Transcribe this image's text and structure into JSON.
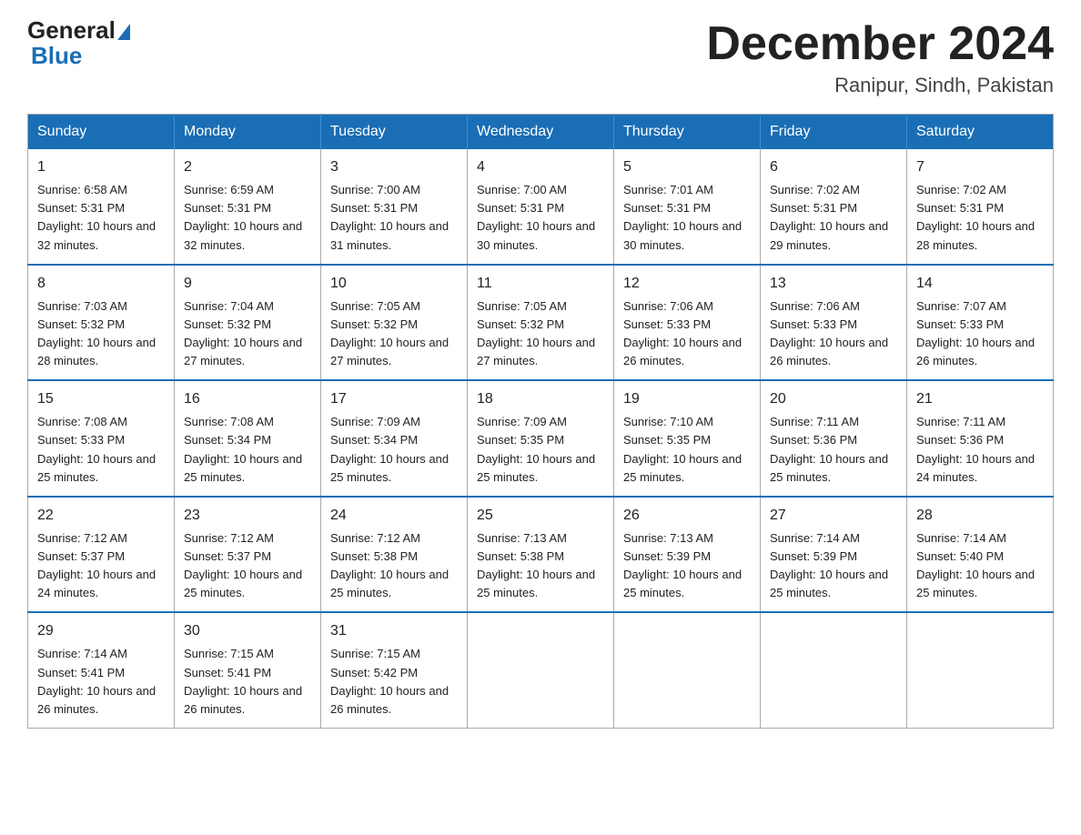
{
  "logo": {
    "general": "General",
    "blue": "Blue"
  },
  "header": {
    "month": "December 2024",
    "location": "Ranipur, Sindh, Pakistan"
  },
  "days_of_week": [
    "Sunday",
    "Monday",
    "Tuesday",
    "Wednesday",
    "Thursday",
    "Friday",
    "Saturday"
  ],
  "weeks": [
    [
      {
        "day": "1",
        "sunrise": "6:58 AM",
        "sunset": "5:31 PM",
        "daylight": "10 hours and 32 minutes."
      },
      {
        "day": "2",
        "sunrise": "6:59 AM",
        "sunset": "5:31 PM",
        "daylight": "10 hours and 32 minutes."
      },
      {
        "day": "3",
        "sunrise": "7:00 AM",
        "sunset": "5:31 PM",
        "daylight": "10 hours and 31 minutes."
      },
      {
        "day": "4",
        "sunrise": "7:00 AM",
        "sunset": "5:31 PM",
        "daylight": "10 hours and 30 minutes."
      },
      {
        "day": "5",
        "sunrise": "7:01 AM",
        "sunset": "5:31 PM",
        "daylight": "10 hours and 30 minutes."
      },
      {
        "day": "6",
        "sunrise": "7:02 AM",
        "sunset": "5:31 PM",
        "daylight": "10 hours and 29 minutes."
      },
      {
        "day": "7",
        "sunrise": "7:02 AM",
        "sunset": "5:31 PM",
        "daylight": "10 hours and 28 minutes."
      }
    ],
    [
      {
        "day": "8",
        "sunrise": "7:03 AM",
        "sunset": "5:32 PM",
        "daylight": "10 hours and 28 minutes."
      },
      {
        "day": "9",
        "sunrise": "7:04 AM",
        "sunset": "5:32 PM",
        "daylight": "10 hours and 27 minutes."
      },
      {
        "day": "10",
        "sunrise": "7:05 AM",
        "sunset": "5:32 PM",
        "daylight": "10 hours and 27 minutes."
      },
      {
        "day": "11",
        "sunrise": "7:05 AM",
        "sunset": "5:32 PM",
        "daylight": "10 hours and 27 minutes."
      },
      {
        "day": "12",
        "sunrise": "7:06 AM",
        "sunset": "5:33 PM",
        "daylight": "10 hours and 26 minutes."
      },
      {
        "day": "13",
        "sunrise": "7:06 AM",
        "sunset": "5:33 PM",
        "daylight": "10 hours and 26 minutes."
      },
      {
        "day": "14",
        "sunrise": "7:07 AM",
        "sunset": "5:33 PM",
        "daylight": "10 hours and 26 minutes."
      }
    ],
    [
      {
        "day": "15",
        "sunrise": "7:08 AM",
        "sunset": "5:33 PM",
        "daylight": "10 hours and 25 minutes."
      },
      {
        "day": "16",
        "sunrise": "7:08 AM",
        "sunset": "5:34 PM",
        "daylight": "10 hours and 25 minutes."
      },
      {
        "day": "17",
        "sunrise": "7:09 AM",
        "sunset": "5:34 PM",
        "daylight": "10 hours and 25 minutes."
      },
      {
        "day": "18",
        "sunrise": "7:09 AM",
        "sunset": "5:35 PM",
        "daylight": "10 hours and 25 minutes."
      },
      {
        "day": "19",
        "sunrise": "7:10 AM",
        "sunset": "5:35 PM",
        "daylight": "10 hours and 25 minutes."
      },
      {
        "day": "20",
        "sunrise": "7:11 AM",
        "sunset": "5:36 PM",
        "daylight": "10 hours and 25 minutes."
      },
      {
        "day": "21",
        "sunrise": "7:11 AM",
        "sunset": "5:36 PM",
        "daylight": "10 hours and 24 minutes."
      }
    ],
    [
      {
        "day": "22",
        "sunrise": "7:12 AM",
        "sunset": "5:37 PM",
        "daylight": "10 hours and 24 minutes."
      },
      {
        "day": "23",
        "sunrise": "7:12 AM",
        "sunset": "5:37 PM",
        "daylight": "10 hours and 25 minutes."
      },
      {
        "day": "24",
        "sunrise": "7:12 AM",
        "sunset": "5:38 PM",
        "daylight": "10 hours and 25 minutes."
      },
      {
        "day": "25",
        "sunrise": "7:13 AM",
        "sunset": "5:38 PM",
        "daylight": "10 hours and 25 minutes."
      },
      {
        "day": "26",
        "sunrise": "7:13 AM",
        "sunset": "5:39 PM",
        "daylight": "10 hours and 25 minutes."
      },
      {
        "day": "27",
        "sunrise": "7:14 AM",
        "sunset": "5:39 PM",
        "daylight": "10 hours and 25 minutes."
      },
      {
        "day": "28",
        "sunrise": "7:14 AM",
        "sunset": "5:40 PM",
        "daylight": "10 hours and 25 minutes."
      }
    ],
    [
      {
        "day": "29",
        "sunrise": "7:14 AM",
        "sunset": "5:41 PM",
        "daylight": "10 hours and 26 minutes."
      },
      {
        "day": "30",
        "sunrise": "7:15 AM",
        "sunset": "5:41 PM",
        "daylight": "10 hours and 26 minutes."
      },
      {
        "day": "31",
        "sunrise": "7:15 AM",
        "sunset": "5:42 PM",
        "daylight": "10 hours and 26 minutes."
      },
      null,
      null,
      null,
      null
    ]
  ]
}
